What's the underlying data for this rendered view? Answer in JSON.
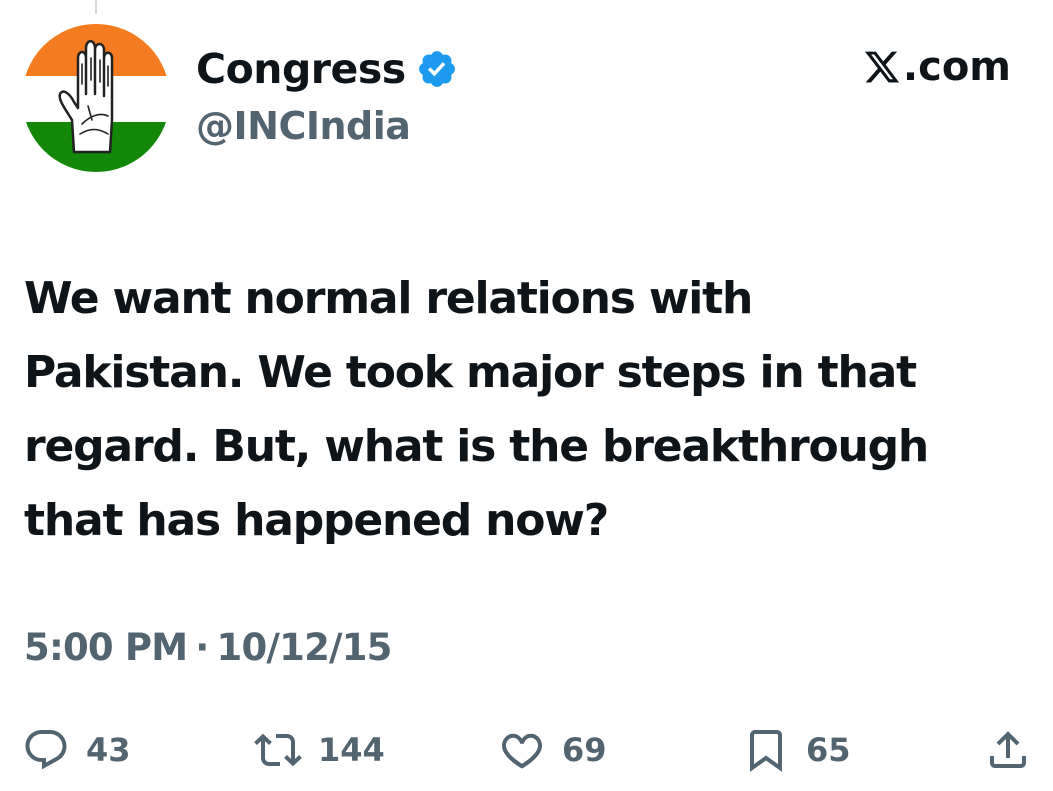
{
  "account": {
    "display_name": "Congress",
    "handle": "@INCIndia",
    "verified": true,
    "avatar_colors": [
      "#f47b20",
      "#ffffff",
      "#138808"
    ]
  },
  "site": {
    "label": ".com",
    "logo": "x-logo-icon"
  },
  "tweet": {
    "lines": [
      "We want normal relations with",
      "Pakistan. We took major steps in that",
      "regard. But, what is the breakthrough",
      "that has happened now?"
    ],
    "time": "5:00 PM",
    "separator": "·",
    "date": "10/12/15"
  },
  "actions": {
    "reply": {
      "icon": "reply-icon",
      "count": "43"
    },
    "retweet": {
      "icon": "retweet-icon",
      "count": "144"
    },
    "like": {
      "icon": "heart-icon",
      "count": "69"
    },
    "bookmark": {
      "icon": "bookmark-icon",
      "count": "65"
    },
    "share": {
      "icon": "share-icon"
    }
  },
  "colors": {
    "text": "#0f1419",
    "secondary": "#536471",
    "verified": "#1d9bf0"
  }
}
